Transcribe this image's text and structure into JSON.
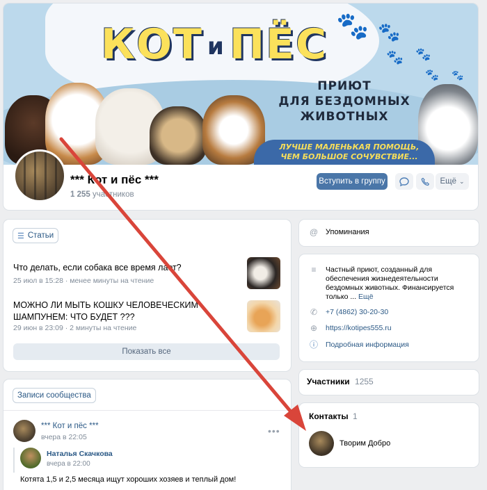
{
  "cover": {
    "title_left": "КОТ",
    "title_and": "и",
    "title_right": "ПЁС",
    "subtitle_line1": "ПРИЮТ",
    "subtitle_line2": "ДЛЯ БЕЗДОМНЫХ",
    "subtitle_line3": "ЖИВОТНЫХ",
    "slogan_line1": "ЛУЧШЕ МАЛЕНЬКАЯ ПОМОЩЬ,",
    "slogan_line2": "ЧЕМ БОЛЬШОЕ СОЧУВСТВИЕ..."
  },
  "group": {
    "name": "*** Кот и пёс ***",
    "members_num": "1 255",
    "members_word": "участников",
    "join_label": "Вступить в группу",
    "more_label": "Ещё"
  },
  "articles": {
    "chip_label": "Статьи",
    "items": [
      {
        "title": "Что делать, если собака все время лает?",
        "meta": "25 июл в 15:28 · менее минуты на чтение"
      },
      {
        "title": "МОЖНО ЛИ МЫТЬ КОШКУ ЧЕЛОВЕЧЕСКИМ ШАМПУНЕМ: ЧТО БУДЕТ ???",
        "meta": "29 июн в 23:09 · 2 минуты на чтение"
      }
    ],
    "show_all": "Показать все"
  },
  "posts": {
    "chip_label": "Записи сообщества",
    "author": "*** Кот и пёс ***",
    "time": "вчера в 22:05",
    "repost_author": "Наталья Скачкова",
    "repost_time": "вчера в 22:00",
    "text": "Котята 1,5 и 2,5 месяца ищут хороших хозяев и теплый дом!"
  },
  "mentions": {
    "label": "Упоминания"
  },
  "about": {
    "description": "Частный приют, созданный для обеспечения жизнедеятельности бездомных животных. Финансируется только ...",
    "more": "Ещё",
    "phone": "+7 (4862) 30-20-30",
    "site": "https://kotipes555.ru",
    "details": "Подробная информация"
  },
  "members_block": {
    "label": "Участники",
    "count": "1255"
  },
  "contacts": {
    "label": "Контакты",
    "count": "1",
    "person": "Творим Добро"
  },
  "colors": {
    "accent": "#4a76a8",
    "link": "#2a5885",
    "arrow": "#d9453a"
  }
}
